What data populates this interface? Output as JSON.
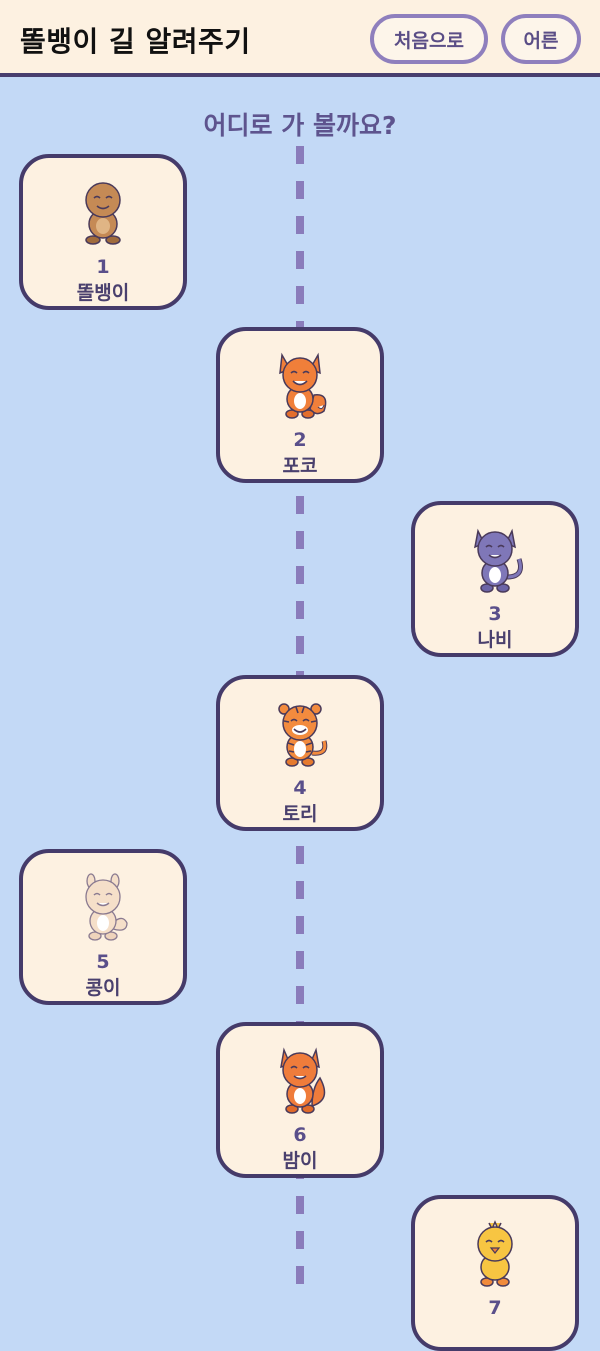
{
  "header": {
    "title": "똘뱅이 길 알려주기",
    "home_label": "처음으로",
    "adult_label": "어른"
  },
  "prompt": "어디로 가 볼까요?",
  "characters": [
    {
      "number": "1",
      "name": "똘뱅이",
      "icon": "brown-bear-icon",
      "color": "#c58a55"
    },
    {
      "number": "2",
      "name": "포코",
      "icon": "orange-fox-icon",
      "color": "#f07f3a"
    },
    {
      "number": "3",
      "name": "나비",
      "icon": "purple-cat-icon",
      "color": "#7f77b8"
    },
    {
      "number": "4",
      "name": "토리",
      "icon": "tiger-icon",
      "color": "#f28b3e"
    },
    {
      "number": "5",
      "name": "콩이",
      "icon": "cream-bunny-icon",
      "color": "#f5dfc9"
    },
    {
      "number": "6",
      "name": "밤이",
      "icon": "orange-squirrel-icon",
      "color": "#ef7c3b"
    },
    {
      "number": "7",
      "name": "",
      "icon": "yellow-chick-icon",
      "color": "#f7c542"
    }
  ]
}
